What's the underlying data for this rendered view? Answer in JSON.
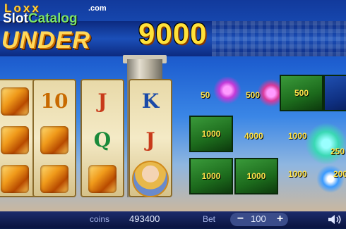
{
  "logo": {
    "top": "Loxx",
    "dotcom": ".com",
    "slot": "Slot",
    "catalog": "Catalog",
    "title": "UNDER"
  },
  "win_amount": "9000",
  "reels": [
    [
      "scroll",
      "scroll",
      "scroll"
    ],
    [
      "10",
      "scroll",
      "scroll"
    ],
    [
      "J",
      "Q",
      "scroll"
    ],
    [
      "K",
      "J",
      "portrait"
    ]
  ],
  "bonus": {
    "box_values": [
      "500",
      "1000",
      "1000",
      "1000"
    ],
    "floating_values": [
      "50",
      "500",
      "4000",
      "1000",
      "250",
      "1000",
      "200"
    ]
  },
  "bottom": {
    "coins_label": "coins",
    "coins_value": "493400",
    "bet_label": "Bet",
    "bet_value": "100",
    "minus": "−",
    "plus": "+"
  },
  "colors": {
    "win": "#ffe23a",
    "green_box": "#2a8a2a"
  }
}
